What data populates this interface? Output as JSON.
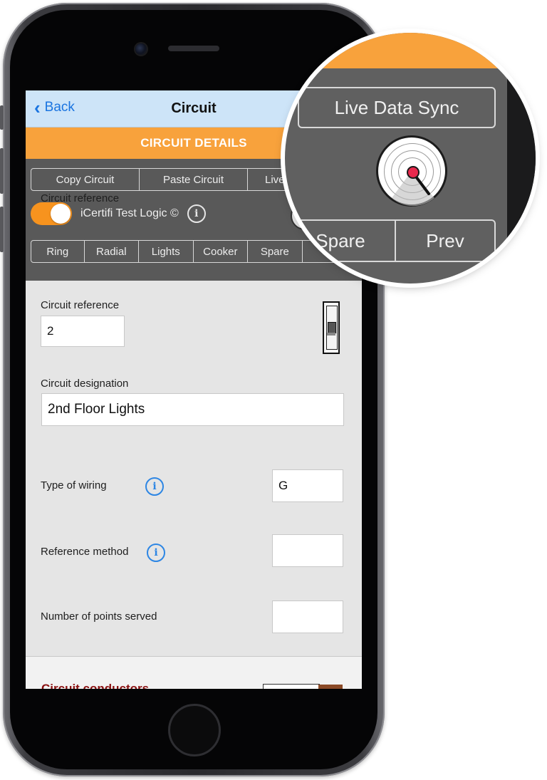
{
  "nav": {
    "back_label": "Back",
    "title": "Circuit"
  },
  "section": {
    "title": "CIRCUIT DETAILS"
  },
  "actions": {
    "copy": "Copy Circuit",
    "paste": "Paste Circuit",
    "live_partial": "Live"
  },
  "test_logic": {
    "label": "iCertifi Test Logic ©",
    "enabled": true,
    "info_icon": "info-icon"
  },
  "circuit_types": [
    {
      "label": "Ring"
    },
    {
      "label": "Radial"
    },
    {
      "label": "Lights"
    },
    {
      "label": "Cooker"
    },
    {
      "label": "Spare"
    },
    {
      "label": "P"
    }
  ],
  "form": {
    "circuit_reference": {
      "label": "Circuit reference",
      "value": "2"
    },
    "circuit_designation": {
      "label": "Circuit designation",
      "value": "2nd Floor Lights"
    },
    "type_of_wiring": {
      "label": "Type of wiring",
      "value": "G"
    },
    "reference_method": {
      "label": "Reference method",
      "value": ""
    },
    "points_served": {
      "label": "Number of points served",
      "value": ""
    }
  },
  "lower_section": {
    "title": "Circuit conductors"
  },
  "magnifier": {
    "live_sync": "Live Data Sync",
    "spare": "Spare",
    "prev": "Prev"
  },
  "colors": {
    "accent": "#f8a23c",
    "nav_bg": "#cde4f8",
    "link": "#1a74e0",
    "toolbar": "#595959",
    "heading_red": "#8a1111"
  }
}
